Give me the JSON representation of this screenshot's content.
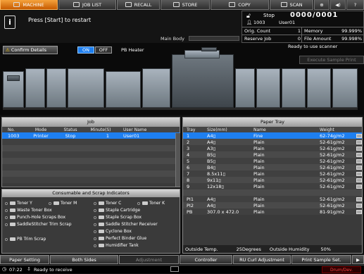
{
  "tabs": [
    {
      "label": "MACHINE",
      "icon": "machine-icon",
      "active": true
    },
    {
      "label": "JOB LIST",
      "icon": "list-icon"
    },
    {
      "label": "RECALL",
      "icon": "recall-icon"
    },
    {
      "label": "STORE",
      "icon": "store-icon"
    },
    {
      "label": "COPY",
      "icon": "copy-icon"
    },
    {
      "label": "SCAN",
      "icon": "scan-icon"
    }
  ],
  "message": "Press [Start] to restart",
  "status": {
    "state": "Stop",
    "counter": "0000/0001",
    "job_id": "1003",
    "user": "User01",
    "orig_count_label": "Orig. Count",
    "orig_count": "1",
    "memory_label": "Memory",
    "memory": "99.999%",
    "reserve_label": "Reserve Job",
    "reserve": "0",
    "file_amount_label": "File Amount",
    "file_amount": "99.998%"
  },
  "main_body_label": "Main Body",
  "ready_text": "Ready to use scanner",
  "confirm_details": "Confirm Details",
  "pb_heater": {
    "on": "ON",
    "off": "OFF",
    "label": "PB Heater"
  },
  "execute_sample": "Execute Sample Print",
  "job_panel": {
    "title": "Job",
    "headers": [
      "No.",
      "Mode",
      "Status",
      "Minute(S)",
      "User Name"
    ],
    "rows": [
      {
        "no": "1003",
        "mode": "Printer",
        "status": "Stop",
        "minute": "1",
        "user": "User01"
      }
    ]
  },
  "paper_panel": {
    "title": "Paper Tray",
    "headers": [
      "Tray",
      "Size(mm)",
      "Name",
      "Weight"
    ],
    "rows": [
      {
        "tray": "1",
        "size": "A4▯",
        "name": "Fine",
        "weight": "62-74g/m2"
      },
      {
        "tray": "2",
        "size": "A4▯",
        "name": "Plain",
        "weight": "52-61g/m2"
      },
      {
        "tray": "3",
        "size": "A3▯",
        "name": "Plain",
        "weight": "52-61g/m2"
      },
      {
        "tray": "4",
        "size": "B5▯",
        "name": "Plain",
        "weight": "52-61g/m2"
      },
      {
        "tray": "5",
        "size": "B5▯",
        "name": "Plain",
        "weight": "52-61g/m2"
      },
      {
        "tray": "6",
        "size": "B4▯",
        "name": "Plain",
        "weight": "52-61g/m2"
      },
      {
        "tray": "7",
        "size": "8.5x11▯",
        "name": "Plain",
        "weight": "52-61g/m2"
      },
      {
        "tray": "8",
        "size": "9x11▯",
        "name": "Plain",
        "weight": "52-61g/m2"
      },
      {
        "tray": "9",
        "size": "12x18▯",
        "name": "Plain",
        "weight": "52-61g/m2"
      },
      {
        "tray": "",
        "size": "",
        "name": "",
        "weight": ""
      },
      {
        "tray": "PI1",
        "size": "A4▯",
        "name": "Plain",
        "weight": "52-61g/m2"
      },
      {
        "tray": "PI2",
        "size": "A4▯",
        "name": "Plain",
        "weight": "52-61g/m2"
      },
      {
        "tray": "PB",
        "size": "307.0 x 472.0",
        "name": "Plain",
        "weight": "81-91g/m2"
      }
    ],
    "outside_temp_label": "Outside Temp.",
    "outside_temp": "25Degrees",
    "outside_humidity_label": "Outside Humidity",
    "outside_humidity": "50%"
  },
  "consumables": {
    "title": "Consumable and Scrap Indicators",
    "toners": [
      "Toner Y",
      "Toner M",
      "Toner C",
      "Toner K"
    ],
    "left": [
      "Waste Toner Box",
      "Punch-Hole Scraps Box",
      "SaddleStitcher Trim Scrap",
      "",
      "PB Trim Scrap"
    ],
    "right": [
      "Staple Cartridge",
      "Staple Scrap Box",
      "Saddle Stitcher Receiver",
      "Cyclone Box",
      "Perfect Binder Glue",
      "Humidifier Tank"
    ]
  },
  "bottom_tabs": [
    "Paper Setting",
    "Both Sides",
    "Adjustment",
    "Controller",
    "RU Curl Adjustment",
    "Print Sample Set."
  ],
  "footer": {
    "time": "07:22",
    "status": "Ready to receive",
    "drum": "Drum/Dev."
  },
  "colors": {
    "accent_orange": "#e07b12",
    "select_blue": "#1e7ff0"
  }
}
